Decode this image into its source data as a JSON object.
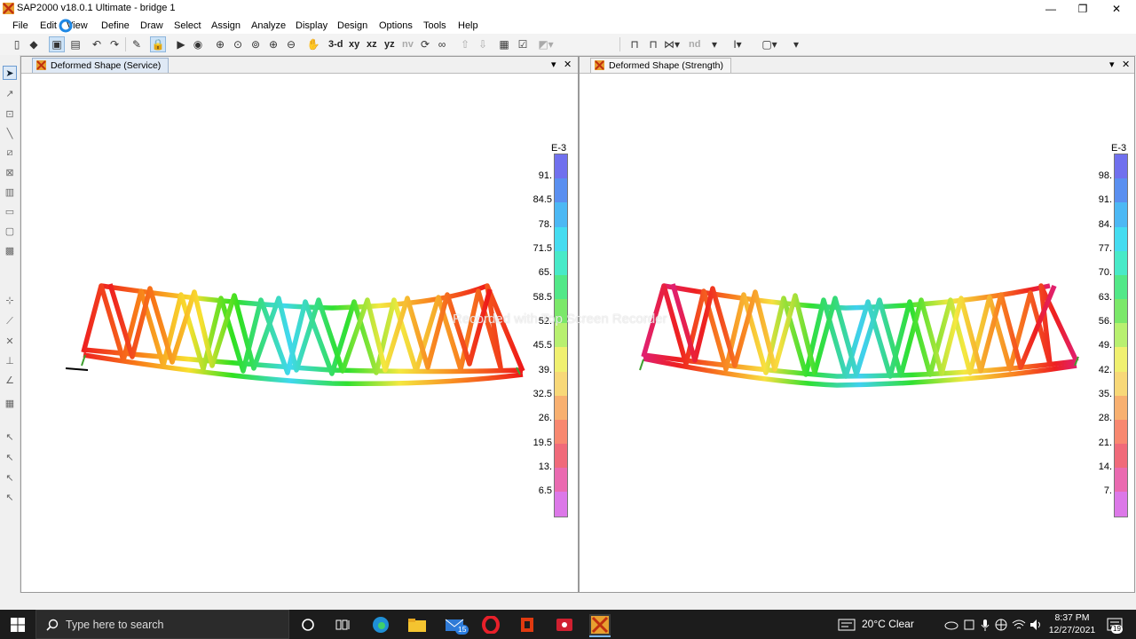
{
  "window": {
    "title": "SAP2000 v18.0.1 Ultimate  - bridge 1",
    "controls": [
      "—",
      "❐",
      "✕"
    ]
  },
  "menu": {
    "items": [
      "File",
      "Edit",
      "View",
      "Define",
      "Draw",
      "Select",
      "Assign",
      "Analyze",
      "Display",
      "Design",
      "Options",
      "Tools",
      "Help"
    ]
  },
  "toolbar": {
    "view_3d": "3-d",
    "view_xy": "xy",
    "view_xz": "xz",
    "view_yz": "yz",
    "view_nv": "nv",
    "nd_label": "nd"
  },
  "panels": {
    "left": {
      "tab": "Deformed Shape (Service)",
      "legend": {
        "exponent": "E-3",
        "labels": [
          "91.",
          "84.5",
          "78.",
          "71.5",
          "65.",
          "58.5",
          "52.",
          "45.5",
          "39.",
          "32.5",
          "26.",
          "19.5",
          "13.",
          "6.5"
        ]
      }
    },
    "right": {
      "tab": "Deformed Shape (Strength)",
      "legend": {
        "exponent": "E-3",
        "labels": [
          "98.",
          "91.",
          "84.",
          "77.",
          "70.",
          "63.",
          "56.",
          "49.",
          "42.",
          "35.",
          "28.",
          "21.",
          "14.",
          "7."
        ]
      }
    },
    "tab_controls": {
      "dropdown": "▾",
      "close": "✕"
    }
  },
  "legend_colors": [
    "#7070ee",
    "#5a8ff0",
    "#4cb8f4",
    "#45dcf0",
    "#48eac8",
    "#52e888",
    "#7be86a",
    "#b8f070",
    "#f0f070",
    "#f8d878",
    "#f8b070",
    "#f88870",
    "#f06a7a",
    "#ea6ab0",
    "#dc78e8"
  ],
  "watermark": "Recorded with Top Screen Recorder",
  "taskbar": {
    "search_placeholder": "Type here to search",
    "mail_badge": "15",
    "weather": "20°C  Clear",
    "time": "8:37 PM",
    "date": "12/27/2021",
    "notification_count": "19"
  }
}
